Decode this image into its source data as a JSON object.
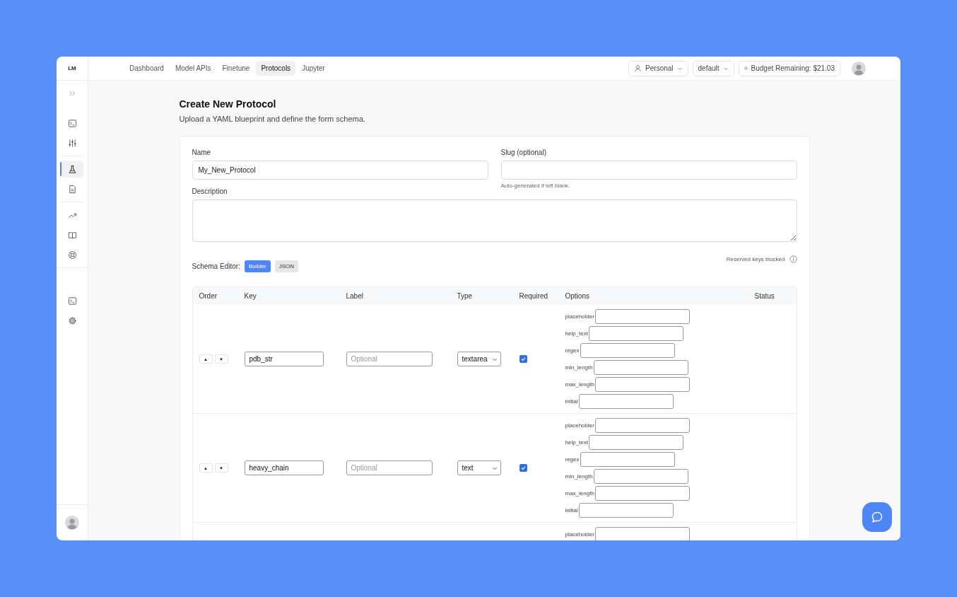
{
  "brand": {
    "logo": "LM"
  },
  "nav": {
    "tabs": [
      {
        "label": "Dashboard",
        "selected": false
      },
      {
        "label": "Model APIs",
        "selected": false
      },
      {
        "label": "Finetune",
        "selected": false
      },
      {
        "label": "Protocols",
        "selected": true
      },
      {
        "label": "Jupyter",
        "selected": false
      }
    ]
  },
  "account": {
    "workspace": "Personal",
    "project": "default",
    "budget": "Budget Remaining: $21.03"
  },
  "sidebar": {
    "groups": [
      {
        "items": [
          {
            "selected": false
          },
          {
            "selected": false
          }
        ]
      },
      {
        "items": [
          {
            "selected": true
          },
          {
            "selected": false
          }
        ]
      },
      {
        "items": [
          {
            "selected": false
          },
          {
            "selected": false
          },
          {
            "selected": false
          }
        ]
      },
      {
        "items": [
          {
            "selected": false
          },
          {
            "selected": false
          }
        ]
      }
    ]
  },
  "page": {
    "title": "Create New Protocol",
    "subtitle": "Upload a YAML blueprint and define the form schema."
  },
  "form": {
    "name": {
      "label": "Name",
      "value": "My_New_Protocol"
    },
    "slug": {
      "label": "Slug (optional)",
      "hint": "Auto-generated if left blank."
    },
    "description": {
      "label": "Description"
    }
  },
  "schema_editor": {
    "label": "Schema Editor:",
    "modes": [
      {
        "label": "Builder",
        "selected": true
      },
      {
        "label": "JSON",
        "selected": false
      }
    ],
    "note": "Reserved keys blocked"
  },
  "table": {
    "columns": [
      "Order",
      "Key",
      "Label",
      "Type",
      "Required",
      "Options",
      "Status"
    ],
    "rows": [
      {
        "up": "▲",
        "down": "▼",
        "key": "pdb_str",
        "label_placeholder": "Optional",
        "type": "textarea",
        "required": true,
        "options": [
          "placeholder",
          "help_text",
          "regex",
          "min_length",
          "max_length",
          "initial"
        ]
      },
      {
        "up": "▲",
        "down": "▼",
        "key": "heavy_chain",
        "label_placeholder": "Optional",
        "type": "text",
        "required": true,
        "options": [
          "placeholder",
          "help_text",
          "regex",
          "min_length",
          "max_length",
          "initial"
        ]
      },
      {
        "options": [
          "placeholder"
        ]
      }
    ]
  }
}
